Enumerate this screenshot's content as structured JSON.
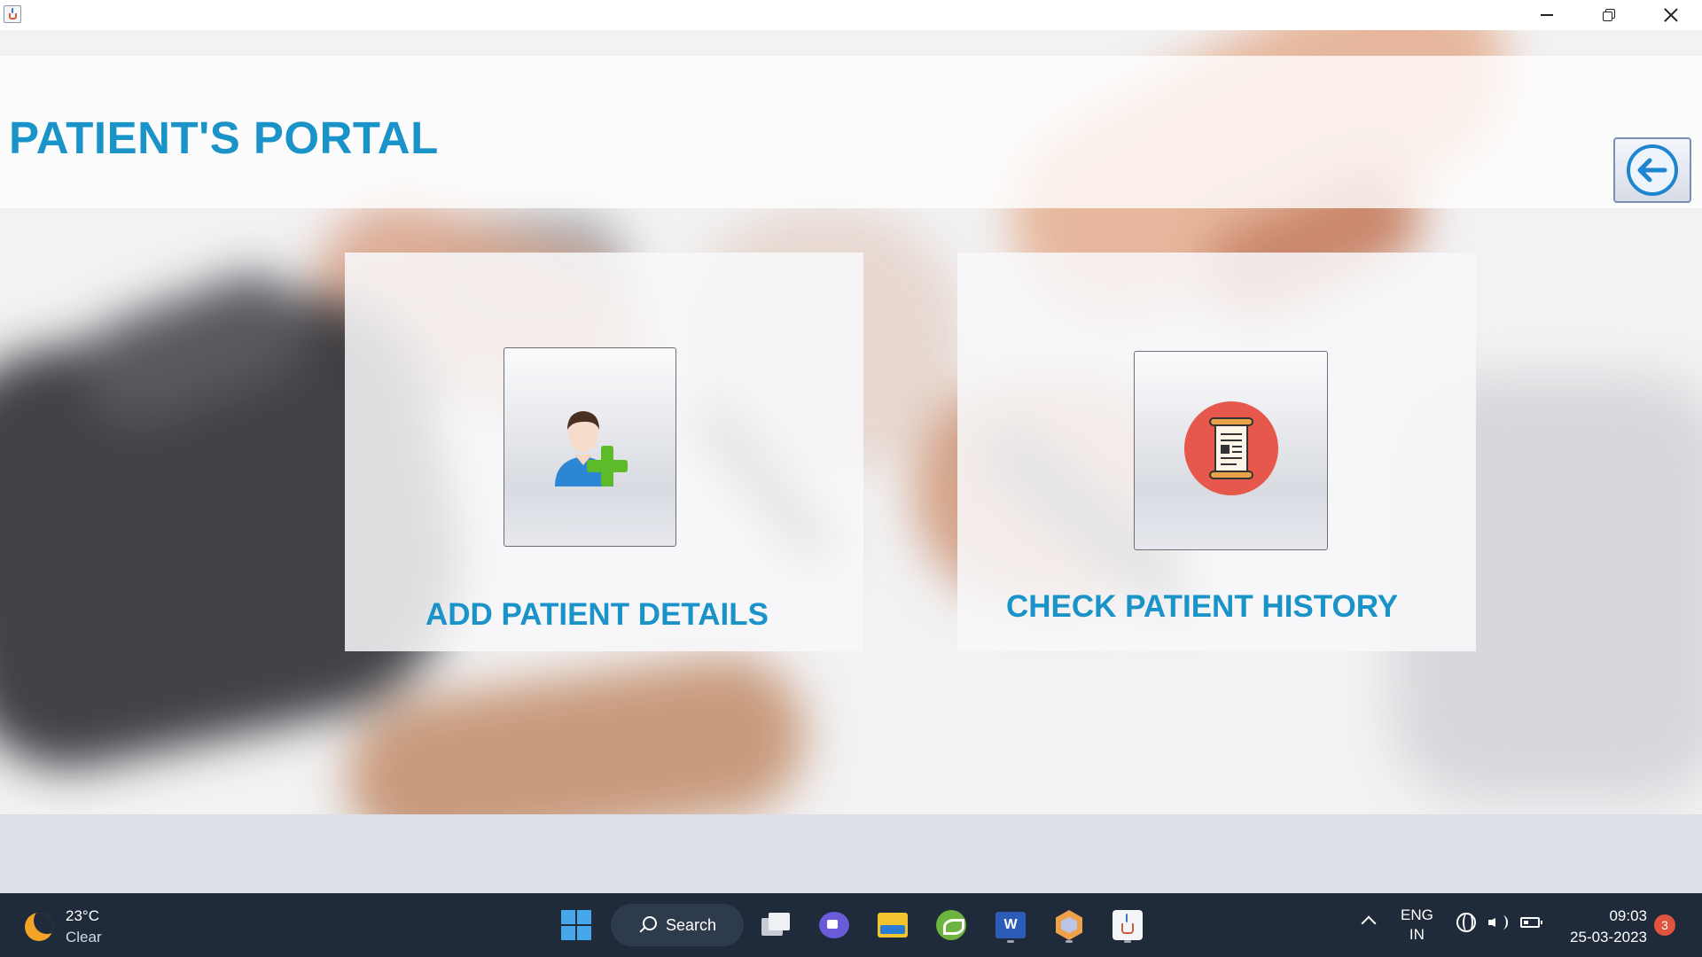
{
  "window": {
    "app_icon": "java-icon",
    "controls": {
      "minimize": "minimize-icon",
      "maximize": "restore-icon",
      "close": "close-icon"
    }
  },
  "page": {
    "title": "PATIENT'S PORTAL",
    "back_button_icon": "back-arrow-icon"
  },
  "actions": [
    {
      "label": "ADD PATIENT DETAILS",
      "icon": "add-user-icon"
    },
    {
      "label": "CHECK PATIENT HISTORY",
      "icon": "scroll-document-icon"
    }
  ],
  "colors": {
    "title": "#1a93c9",
    "label": "#1a93c9",
    "taskbar": "#1f2b3a",
    "accent": "#1e86d0"
  },
  "taskbar": {
    "weather": {
      "temp": "23°C",
      "condition": "Clear",
      "icon": "moon-icon"
    },
    "start_icon": "windows-start-icon",
    "search_label": "Search",
    "apps": [
      "task-view-icon",
      "meet-icon",
      "file-explorer-icon",
      "spring-icon",
      "word-icon",
      "virtualbox-icon",
      "java-icon"
    ],
    "tray": {
      "lang_top": "ENG",
      "lang_bottom": "IN",
      "time": "09:03",
      "date": "25-03-2023",
      "notification_count": "3"
    }
  }
}
